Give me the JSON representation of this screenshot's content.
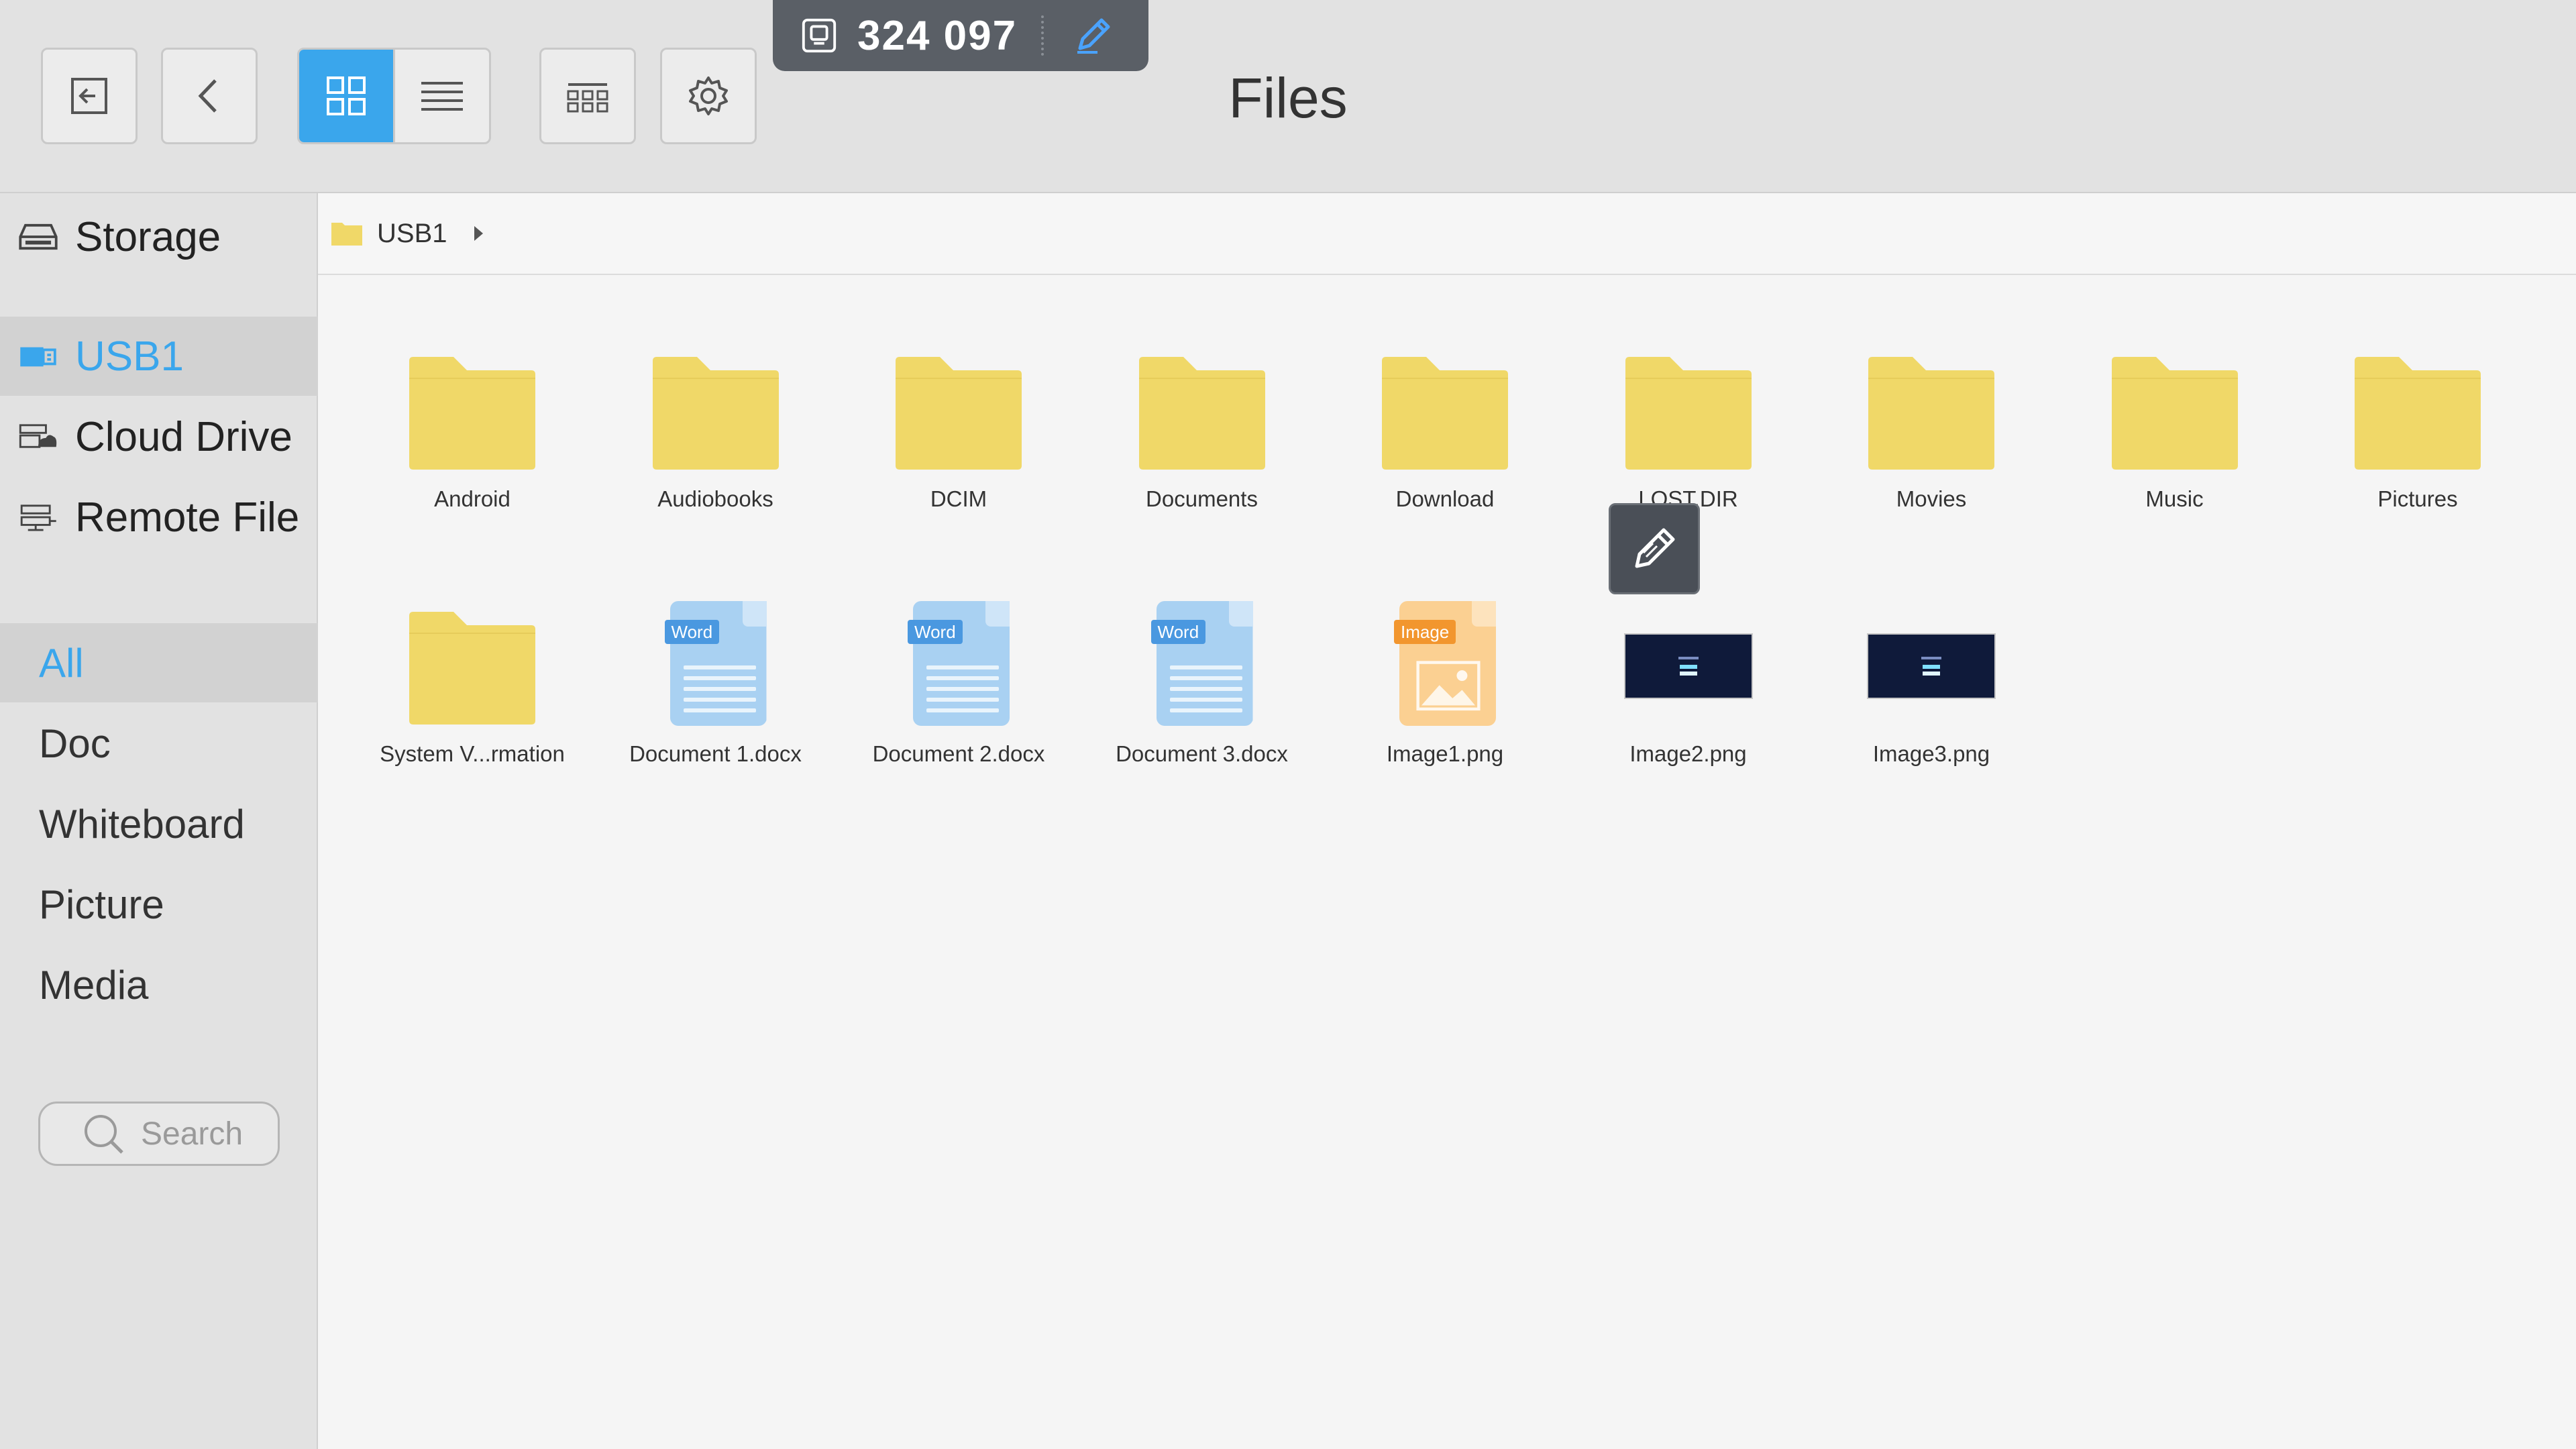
{
  "header": {
    "title": "Files",
    "session_code": "324 097"
  },
  "toolbar": {
    "buttons": [
      {
        "name": "exit-button",
        "icon": "exit-icon"
      },
      {
        "name": "back-button",
        "icon": "chevron-left-icon"
      },
      {
        "name": "grid-view-button",
        "icon": "grid-icon",
        "active": true
      },
      {
        "name": "list-view-button",
        "icon": "list-icon"
      },
      {
        "name": "multi-select-button",
        "icon": "multi-select-icon"
      },
      {
        "name": "settings-button",
        "icon": "gear-icon"
      }
    ]
  },
  "sidebar": {
    "locations": [
      {
        "label": "Storage",
        "icon": "drive-icon"
      },
      {
        "label": "USB1",
        "icon": "usb-icon",
        "active": true
      },
      {
        "label": "Cloud Drive",
        "icon": "cloud-drive-icon"
      },
      {
        "label": "Remote File",
        "icon": "remote-file-icon"
      }
    ],
    "categories": [
      {
        "label": "All",
        "active": true
      },
      {
        "label": "Doc"
      },
      {
        "label": "Whiteboard"
      },
      {
        "label": "Picture"
      },
      {
        "label": "Media"
      }
    ],
    "search_placeholder": "Search"
  },
  "breadcrumb": {
    "items": [
      "USB1"
    ]
  },
  "files": [
    {
      "name": "Android",
      "type": "folder"
    },
    {
      "name": "Audiobooks",
      "type": "folder"
    },
    {
      "name": "DCIM",
      "type": "folder"
    },
    {
      "name": "Documents",
      "type": "folder"
    },
    {
      "name": "Download",
      "type": "folder"
    },
    {
      "name": "LOST.DIR",
      "type": "folder"
    },
    {
      "name": "Movies",
      "type": "folder"
    },
    {
      "name": "Music",
      "type": "folder"
    },
    {
      "name": "Pictures",
      "type": "folder"
    },
    {
      "name": "System V...rmation",
      "type": "folder"
    },
    {
      "name": "Document 1.docx",
      "type": "word",
      "tag": "Word"
    },
    {
      "name": "Document 2.docx",
      "type": "word",
      "tag": "Word"
    },
    {
      "name": "Document 3.docx",
      "type": "word",
      "tag": "Word"
    },
    {
      "name": "Image1.png",
      "type": "image",
      "tag": "Image"
    },
    {
      "name": "Image2.png",
      "type": "thumb"
    },
    {
      "name": "Image3.png",
      "type": "thumb"
    }
  ],
  "colors": {
    "accent": "#3aa6ec",
    "folder": "#f0d868",
    "word": "#a9d1f2",
    "word_tag": "#4a98e0",
    "image": "#fbd092",
    "image_tag": "#f2962e"
  }
}
